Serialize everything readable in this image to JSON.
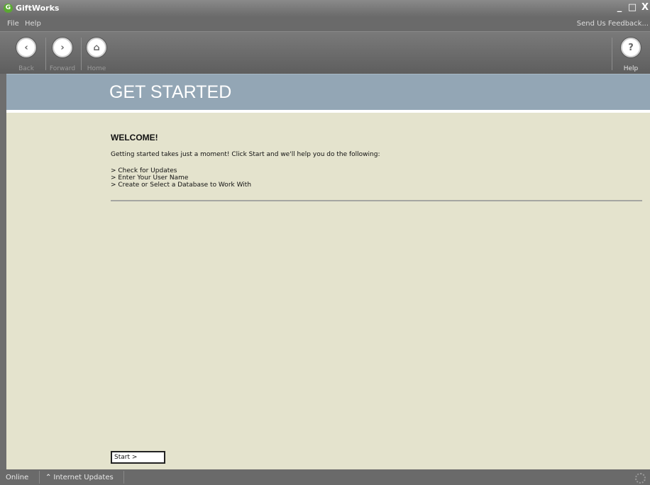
{
  "app": {
    "title": "GiftWorks",
    "logo_glyph": "G"
  },
  "window_buttons": {
    "minimize": "_",
    "maximize": "□",
    "close": "X"
  },
  "menu": {
    "file": "File",
    "help": "Help",
    "feedback": "Send Us Feedback..."
  },
  "toolbar": {
    "back": {
      "label": "Back",
      "glyph": "‹"
    },
    "forward": {
      "label": "Forward",
      "glyph": "›"
    },
    "home": {
      "label": "Home",
      "glyph": "⌂"
    },
    "help": {
      "label": "Help",
      "glyph": "?"
    }
  },
  "header": {
    "title": "GET STARTED"
  },
  "content": {
    "welcome": "WELCOME!",
    "intro": "Getting started takes just a moment! Click Start and we'll help you do the following:",
    "steps": [
      "> Check for Updates",
      "> Enter Your User Name",
      "> Create or Select a Database to Work With"
    ],
    "start_button": "Start >"
  },
  "statusbar": {
    "online": "Online",
    "updates_icon": "⌃",
    "updates": "Internet Updates"
  }
}
